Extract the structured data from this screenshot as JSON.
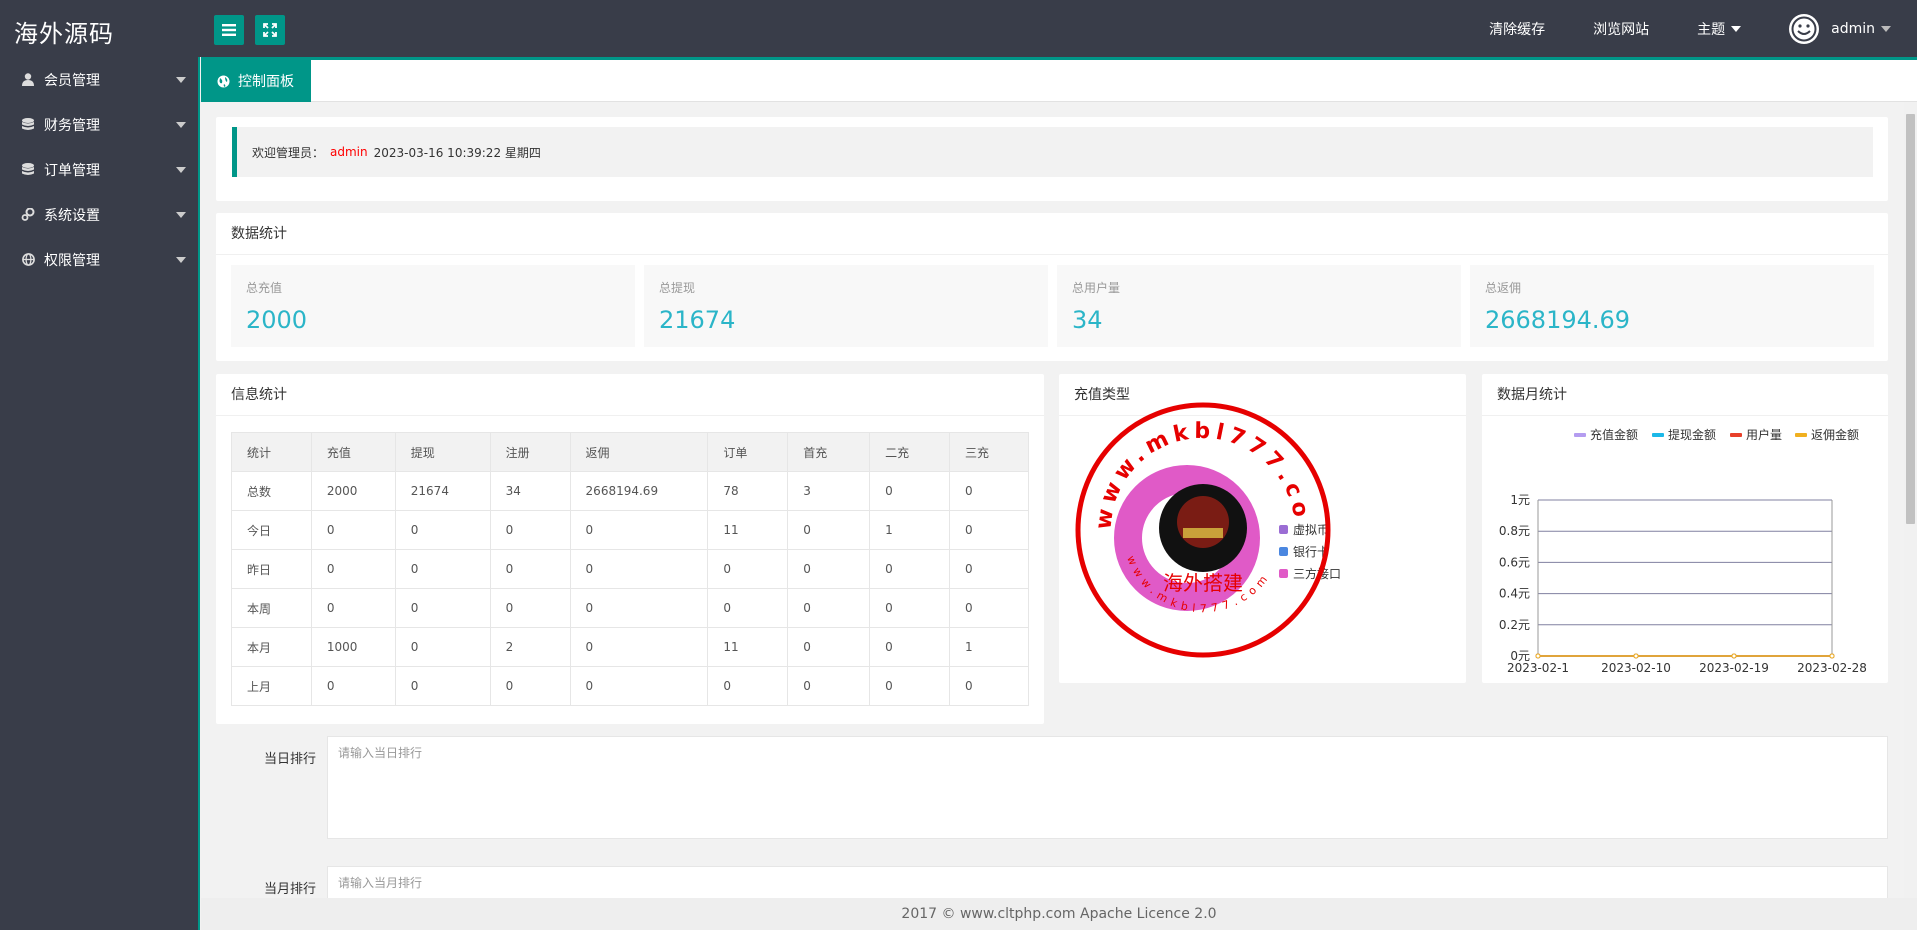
{
  "header": {
    "logo": "海外源码",
    "links": [
      {
        "label": "清除缓存"
      },
      {
        "label": "浏览网站"
      },
      {
        "label": "主题"
      }
    ],
    "user": "admin"
  },
  "sidebar": {
    "items": [
      {
        "label": "会员管理",
        "icon": "user-icon"
      },
      {
        "label": "财务管理",
        "icon": "database-icon"
      },
      {
        "label": "订单管理",
        "icon": "database-icon"
      },
      {
        "label": "系统设置",
        "icon": "gears-icon"
      },
      {
        "label": "权限管理",
        "icon": "globe-icon"
      }
    ]
  },
  "tabs": {
    "active": "控制面板"
  },
  "welcome": {
    "prefix": "欢迎管理员：",
    "user": "admin",
    "datetime": "2023-03-16  10:39:22  星期四"
  },
  "data_stats": {
    "title": "数据统计",
    "boxes": [
      {
        "label": "总充值",
        "value": "2000"
      },
      {
        "label": "总提现",
        "value": "21674"
      },
      {
        "label": "总用户量",
        "value": "34"
      },
      {
        "label": "总返佣",
        "value": "2668194.69"
      }
    ]
  },
  "info_stats": {
    "title": "信息统计",
    "headers": [
      "统计",
      "充值",
      "提现",
      "注册",
      "返佣",
      "订单",
      "首充",
      "二充",
      "三充"
    ],
    "rows": [
      [
        "总数",
        "2000",
        "21674",
        "34",
        "2668194.69",
        "78",
        "3",
        "0",
        "0"
      ],
      [
        "今日",
        "0",
        "0",
        "0",
        "0",
        "11",
        "0",
        "1",
        "0"
      ],
      [
        "昨日",
        "0",
        "0",
        "0",
        "0",
        "0",
        "0",
        "0",
        "0"
      ],
      [
        "本周",
        "0",
        "0",
        "0",
        "0",
        "0",
        "0",
        "0",
        "0"
      ],
      [
        "本月",
        "1000",
        "0",
        "2",
        "0",
        "11",
        "0",
        "0",
        "1"
      ],
      [
        "上月",
        "0",
        "0",
        "0",
        "0",
        "0",
        "0",
        "0",
        "0"
      ]
    ]
  },
  "recharge_type": {
    "title": "充值类型",
    "watermark": {
      "top": "www.mkbl777.com",
      "bottom": "www.mkbl777.com",
      "center": "海外搭建"
    }
  },
  "monthly": {
    "title": "数据月统计"
  },
  "chart_data": [
    {
      "type": "pie",
      "title": "充值类型",
      "legend": [
        "虚拟币",
        "银行卡",
        "三方接口"
      ],
      "values": [
        0,
        0,
        2000
      ],
      "colors": [
        "#9b6dd4",
        "#4b87e0",
        "#e05ac7"
      ],
      "legend_position": "right"
    },
    {
      "type": "line",
      "title": "数据月统计",
      "x": [
        "2023-02-1",
        "2023-02-10",
        "2023-02-19",
        "2023-02-28"
      ],
      "series": [
        {
          "name": "充值金额",
          "values": [
            0,
            0,
            0,
            0
          ],
          "color": "#b49cf0"
        },
        {
          "name": "提现金额",
          "values": [
            0,
            0,
            0,
            0
          ],
          "color": "#1cb8e8"
        },
        {
          "name": "用户量",
          "values": [
            0,
            0,
            0,
            0
          ],
          "color": "#e8402a"
        },
        {
          "name": "返佣金额",
          "values": [
            0,
            0,
            0,
            0
          ],
          "color": "#f0b020"
        }
      ],
      "yticks": [
        "0元",
        "0.2元",
        "0.4元",
        "0.6元",
        "0.8元",
        "1元"
      ],
      "ylim": [
        0,
        1
      ],
      "legend_position": "top-right"
    }
  ],
  "forms": {
    "daily": {
      "label": "当日排行",
      "placeholder": "请输入当日排行"
    },
    "monthly": {
      "label": "当月排行",
      "placeholder": "请输入当月排行"
    }
  },
  "footer": {
    "text": "2017 ©  www.cltphp.com  Apache Licence 2.0"
  },
  "colors": {
    "header_bg": "#393d49",
    "accent": "#009688",
    "stat_value": "#2bb5c8"
  }
}
